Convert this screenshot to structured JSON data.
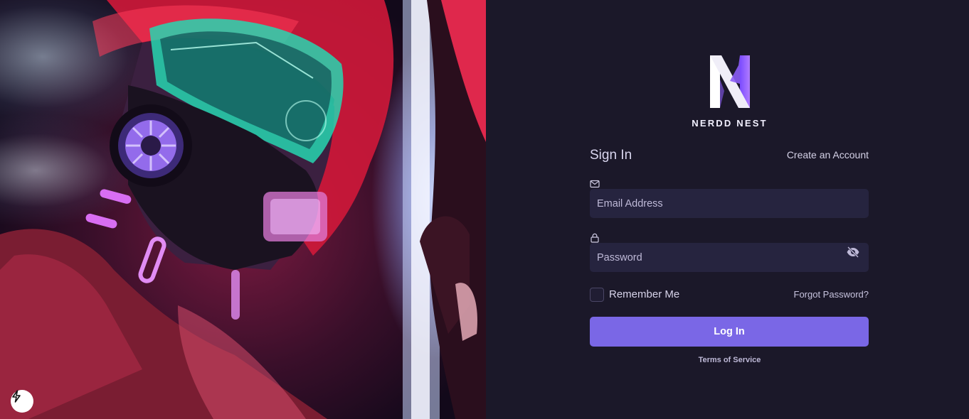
{
  "brand": {
    "name": "NERDD NEST",
    "logo_icon": "n-logo-icon",
    "logo_colors": [
      "#ffffff",
      "#8b5cf6"
    ]
  },
  "auth": {
    "title": "Sign In",
    "create_account_link": "Create an Account",
    "email": {
      "icon": "envelope-icon",
      "placeholder": "Email Address",
      "value": ""
    },
    "password": {
      "icon": "lock-icon",
      "placeholder": "Password",
      "value": "",
      "toggle_icon": "eye-off-icon"
    },
    "remember_me": {
      "label": "Remember Me",
      "checked": false
    },
    "forgot_password_link": "Forgot Password?",
    "login_button": "Log In",
    "terms_link": "Terms of Service"
  },
  "hero": {
    "description_icon": "bolt-badge-icon"
  },
  "colors": {
    "background": "#1b1829",
    "field": "#26243f",
    "accent": "#7a67e6"
  }
}
